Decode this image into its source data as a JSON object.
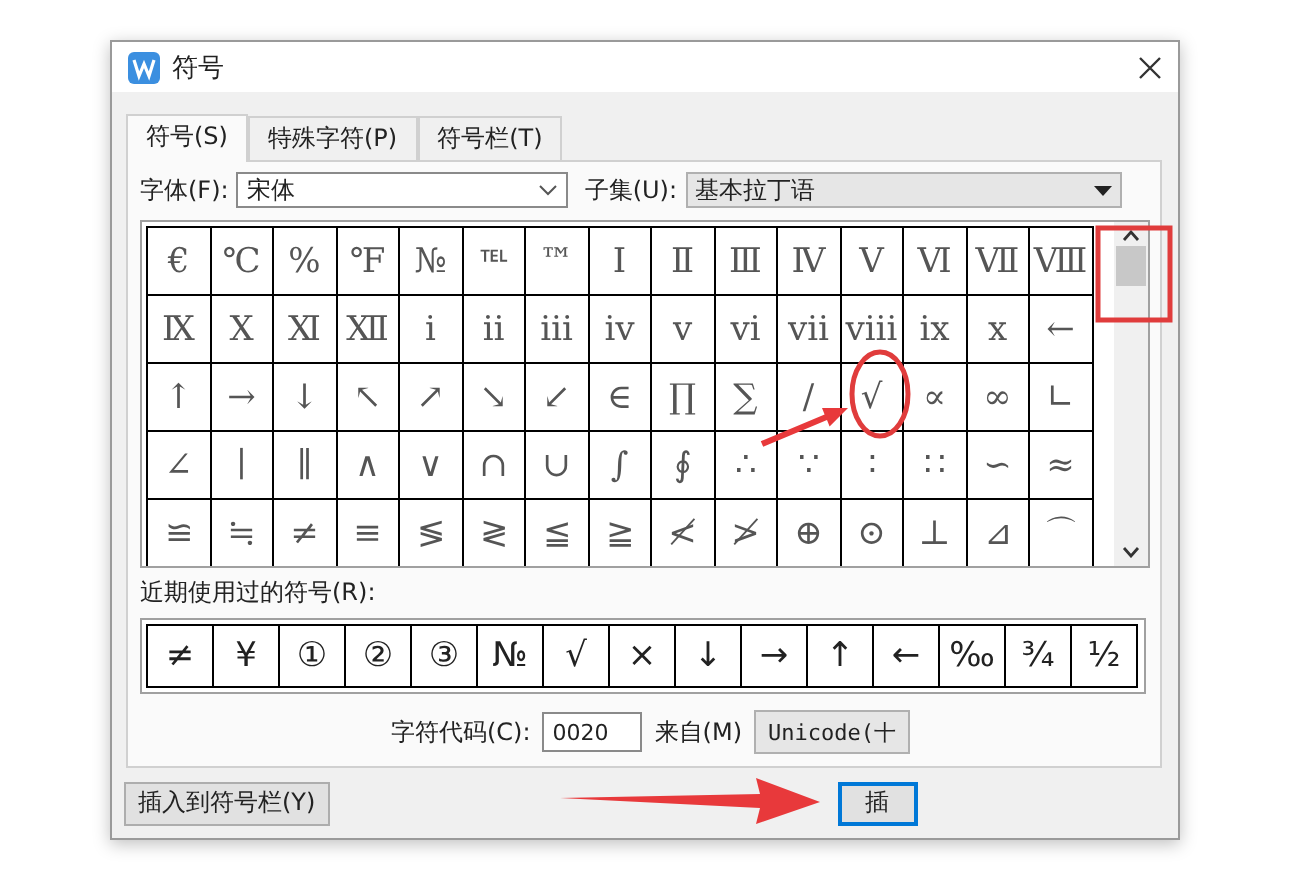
{
  "window": {
    "title": "符号"
  },
  "tabs": [
    {
      "label": "符号(S)",
      "selected": true
    },
    {
      "label": "特殊字符(P)",
      "selected": false
    },
    {
      "label": "符号栏(T)",
      "selected": false
    }
  ],
  "font": {
    "label": "字体(F):",
    "value": "宋体"
  },
  "subset": {
    "label": "子集(U):",
    "value": "基本拉丁语"
  },
  "grid": {
    "rows": [
      [
        "€",
        "℃",
        "%",
        "℉",
        "№",
        "℡",
        "™",
        "Ⅰ",
        "Ⅱ",
        "Ⅲ",
        "Ⅳ",
        "Ⅴ",
        "Ⅵ",
        "Ⅶ",
        "Ⅷ"
      ],
      [
        "Ⅸ",
        "Ⅹ",
        "Ⅺ",
        "Ⅻ",
        "ⅰ",
        "ⅱ",
        "ⅲ",
        "ⅳ",
        "ⅴ",
        "ⅵ",
        "ⅶ",
        "ⅷ",
        "ⅸ",
        "ⅹ",
        "←"
      ],
      [
        "↑",
        "→",
        "↓",
        "↖",
        "↗",
        "↘",
        "↙",
        "∈",
        "∏",
        "∑",
        "∕",
        "√",
        "∝",
        "∞",
        "∟"
      ],
      [
        "∠",
        "∣",
        "∥",
        "∧",
        "∨",
        "∩",
        "∪",
        "∫",
        "∮",
        "∴",
        "∵",
        "∶",
        "∷",
        "∽",
        "≈"
      ],
      [
        "≌",
        "≒",
        "≠",
        "≡",
        "≶",
        "≷",
        "≦",
        "≧",
        "≮",
        "≯",
        "⊕",
        "⊙",
        "⊥",
        "⊿",
        "⌒"
      ]
    ]
  },
  "recent": {
    "label": "近期使用过的符号(R):",
    "symbols": [
      "≠",
      "¥",
      "①",
      "②",
      "③",
      "№",
      "√",
      "×",
      "↓",
      "→",
      "↑",
      "←",
      "‰",
      "¾",
      "½"
    ]
  },
  "char_code": {
    "label": "字符代码(C):",
    "value": "0020"
  },
  "from": {
    "label": "来自(M)",
    "value": "Unicode(十"
  },
  "buttons": [
    {
      "label": "插入到符号栏(Y)",
      "default": false
    },
    {
      "label": "插",
      "default": true
    }
  ]
}
